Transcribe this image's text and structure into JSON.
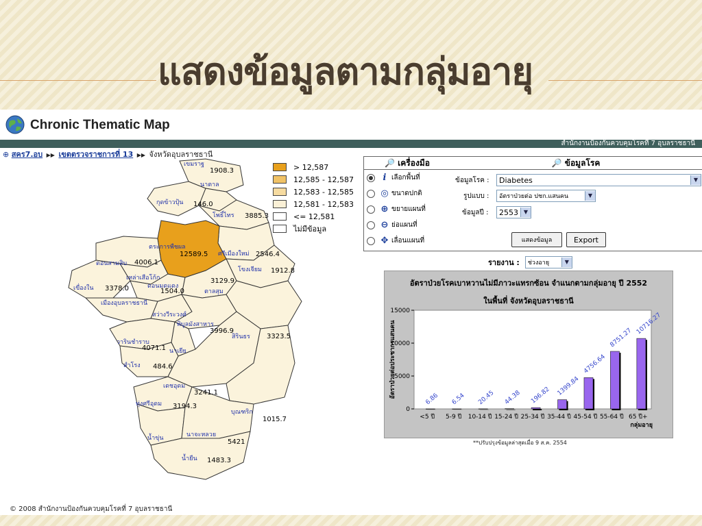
{
  "slide": {
    "title": "แสดงข้อมูลตามกลุ่มอายุ"
  },
  "app": {
    "title": "Chronic Thematic Map",
    "org": "สำนักงานป้องกันควบคุมโรคที่ 7 อุบลราชธานี",
    "footer": "© 2008 สำนักงานป้องกันควบคุมโรคที่ 7 อุบลราชธานี",
    "update_note": "**ปรับปรุงข้อมูลล่าสุดเมื่อ 9 ส.ค. 2554"
  },
  "breadcrumb": {
    "home": "สคร7.อบ",
    "region": "เขตตรวจราชการที่ 13",
    "province": "จังหวัดอุบลราชธานี"
  },
  "legend": [
    {
      "label": "> 12,587",
      "color": "#e8a01c"
    },
    {
      "label": "12,585 - 12,587",
      "color": "#f0c266"
    },
    {
      "label": "12,583 - 12,585",
      "color": "#f6dba0"
    },
    {
      "label": "12,581 - 12,583",
      "color": "#faf0d6"
    },
    {
      "label": "<= 12,581",
      "color": "#ffffff"
    },
    {
      "label": "ไม่มีข้อมูล",
      "color": "#ffffff"
    }
  ],
  "map": {
    "labels": [
      "เขมราฐ",
      "นาตาล",
      "กุดข้าวปุ้น",
      "โพธิ์ไทร",
      "ตระการพืชผล",
      "ศรีเมืองใหม่",
      "ดอนสามสิบ",
      "เหล่าเสือโก้ก",
      "โขงเจียม",
      "เขื่องใน",
      "ดอนมดแดง",
      "ตาลสุม",
      "เมืองอุบลราชธานี",
      "สว่างวีระวงศ์",
      "พิบูลมังสาหาร",
      "วารินชำราบ",
      "สิรินธร",
      "นาเยีย",
      "สำโรง",
      "เดชอุดม",
      "ทุ่งศรีอุดม",
      "บุณฑริก",
      "น้ำขุ่น",
      "นาจะหลวย",
      "น้ำยืน"
    ],
    "values": [
      "1908.3",
      "146.0",
      "3885.3",
      "12589.5",
      "2546.4",
      "4006.1",
      "1912.8",
      "3378.0",
      "3129.9",
      "1504.0",
      "3996.9",
      "3323.5",
      "4071.1",
      "484.6",
      "3241.1",
      "3194.3",
      "1015.7",
      "5421",
      "1483.3"
    ]
  },
  "tools": {
    "header": "เครื่องมือ",
    "items": [
      {
        "label": "เลือกพื้นที่",
        "icon": "info-icon",
        "selected": true
      },
      {
        "label": "ขนาดปกติ",
        "icon": "zoom-reset-icon",
        "selected": false
      },
      {
        "label": "ขยายแผนที่",
        "icon": "zoom-in-icon",
        "selected": false
      },
      {
        "label": "ย่อแผนที่",
        "icon": "zoom-out-icon",
        "selected": false
      },
      {
        "label": "เลื่อนแผนที่",
        "icon": "pan-icon",
        "selected": false
      }
    ]
  },
  "info": {
    "header": "ข้อมูลโรค",
    "disease_label": "ข้อมูลโรค :",
    "disease_value": "Diabetes",
    "format_label": "รูปแบบ :",
    "format_value": "อัตราป่วยต่อ ปชก.แสนคน",
    "year_label": "ข้อมูลปี :",
    "year_value": "2553",
    "show_button": "แสดงข้อมูล",
    "export_button": "Export"
  },
  "report": {
    "label": "รายงาน :",
    "value": "ช่วงอายุ"
  },
  "chart_data": {
    "type": "bar",
    "title": "อัตราป่วยโรคเบาหวานไม่มีภาวะแทรกซ้อน จำแนกตามกลุ่มอายุ ปี 2552",
    "subtitle": "ในพื้นที่ จังหวัดอุบลราชธานี",
    "xlabel": "กลุ่มอายุ",
    "ylabel": "อัตราป่วยต่อประชากรแสนคน",
    "categories": [
      "<5 ปี",
      "5-9 ปี",
      "10-14 ปี",
      "15-24 ปี",
      "25-34 ปี",
      "35-44 ปี",
      "45-54 ปี",
      "55-64 ปี",
      "65 ปี+"
    ],
    "values": [
      6.86,
      6.54,
      20.45,
      44.38,
      196.82,
      1399.84,
      4756.64,
      8751.27,
      10716.27
    ],
    "ylim": [
      0,
      15000
    ],
    "yticks": [
      "0",
      "5000",
      "10000",
      "15000"
    ],
    "bar_color": "#9966ee",
    "label_color": "#3344cc",
    "grid": false
  }
}
